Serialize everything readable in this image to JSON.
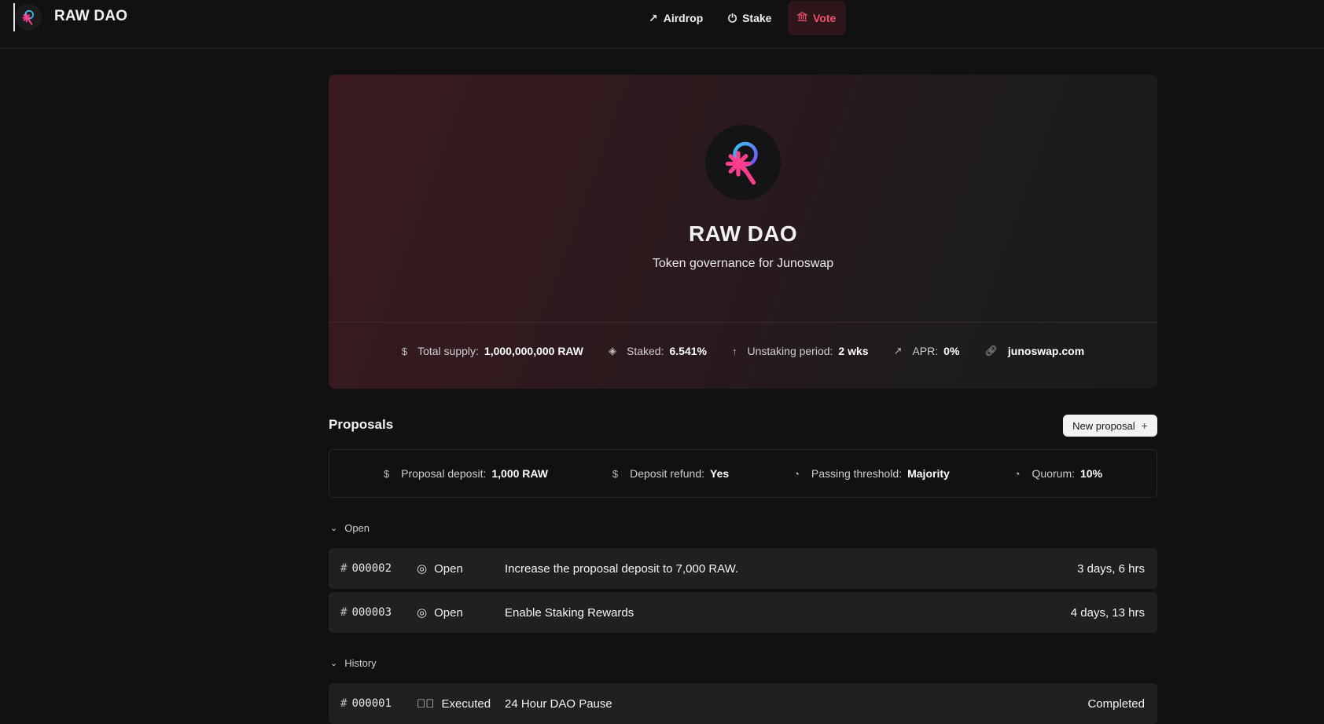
{
  "app": {
    "name": "RAW DAO"
  },
  "nav": [
    {
      "label": "Airdrop",
      "icon": "arrow-up-right-icon",
      "active": false
    },
    {
      "label": "Stake",
      "icon": "power-icon",
      "active": false
    },
    {
      "label": "Vote",
      "icon": "bank-icon",
      "active": true
    }
  ],
  "colors": {
    "accent": "#f0526d",
    "background": "#111113",
    "row": "#202023"
  },
  "hero": {
    "title": "RAW DAO",
    "subtitle": "Token governance for Junoswap",
    "stats": [
      {
        "icon": "dollar-icon",
        "label": "Total supply:",
        "value": "1,000,000,000 RAW"
      },
      {
        "icon": "layers-icon",
        "label": "Staked:",
        "value": "6.541%"
      },
      {
        "icon": "arrow-up-icon",
        "label": "Unstaking period:",
        "value": "2 wks"
      },
      {
        "icon": "arrow-up-right-icon",
        "label": "APR:",
        "value": "0%"
      },
      {
        "icon": "link-icon",
        "label": "",
        "value": "junoswap.com"
      }
    ]
  },
  "proposals": {
    "title": "Proposals",
    "new_button": "New proposal",
    "params": [
      {
        "icon": "dollar-icon",
        "label": "Proposal deposit:",
        "value": "1,000 RAW"
      },
      {
        "icon": "dollar-icon",
        "label": "Deposit refund:",
        "value": "Yes"
      },
      {
        "icon": "pie-icon",
        "label": "Passing threshold:",
        "value": "Majority"
      },
      {
        "icon": "pie-icon",
        "label": "Quorum:",
        "value": "10%"
      }
    ],
    "open_label": "Open",
    "history_label": "History",
    "hash": "#",
    "open": [
      {
        "id": "000002",
        "status": "Open",
        "title": "Increase the proposal deposit to 7,000 RAW.",
        "time": "3 days, 6 hrs"
      },
      {
        "id": "000003",
        "status": "Open",
        "title": "Enable Staking Rewards",
        "time": "4 days, 13 hrs"
      }
    ],
    "history": [
      {
        "id": "000001",
        "status": "Executed",
        "title": "24 Hour DAO Pause",
        "time": "Completed"
      }
    ]
  }
}
